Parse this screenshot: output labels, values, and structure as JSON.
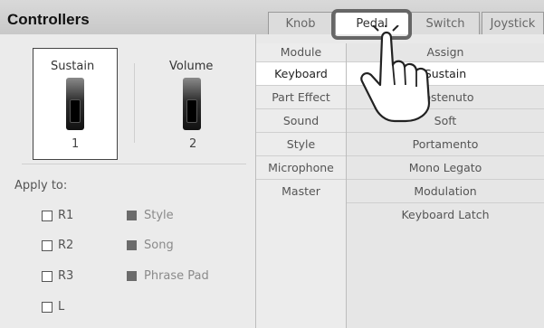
{
  "title": "Controllers",
  "tabs": [
    {
      "label": "Knob"
    },
    {
      "label": "Pedal"
    },
    {
      "label": "Switch"
    },
    {
      "label": "Joystick"
    }
  ],
  "pedals": [
    {
      "name": "Sustain",
      "number": "1"
    },
    {
      "name": "Volume",
      "number": "2"
    }
  ],
  "apply": {
    "label": "Apply to:",
    "parts": [
      "R1",
      "R2",
      "R3",
      "L"
    ],
    "targets": [
      "Style",
      "Song",
      "Phrase Pad"
    ]
  },
  "module": {
    "header": "Module",
    "items": [
      "Keyboard",
      "Part Effect",
      "Sound",
      "Style",
      "Microphone",
      "Master"
    ]
  },
  "assign": {
    "header": "Assign",
    "items": [
      "Sustain",
      "Sostenuto",
      "Soft",
      "Portamento",
      "Mono Legato",
      "Modulation",
      "Keyboard Latch"
    ]
  }
}
